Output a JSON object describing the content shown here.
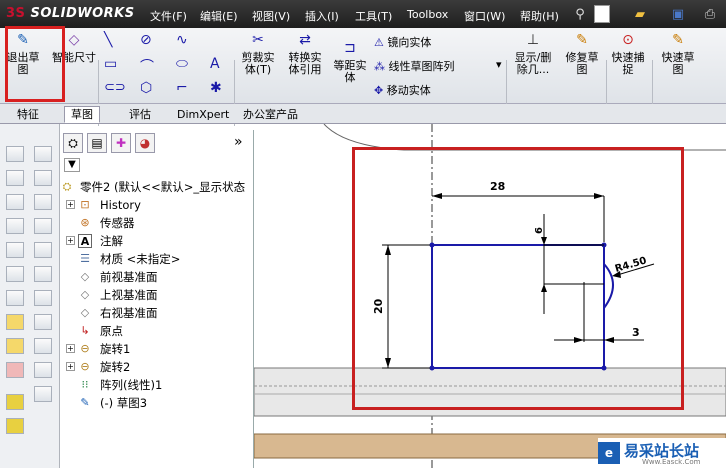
{
  "app": {
    "logo_prefix": "3S",
    "logo_text": "SOLIDWORKS"
  },
  "menu": [
    "文件(F)",
    "编辑(E)",
    "视图(V)",
    "插入(I)",
    "工具(T)",
    "Toolbox",
    "窗口(W)",
    "帮助(H)"
  ],
  "ribbon": {
    "exit_sketch": "退出草图",
    "smart_dimension": "智能尺寸",
    "trim": "剪裁实体(T)",
    "convert": "转换实体引用",
    "offset": "等距实体",
    "mirror": "镜向实体",
    "linear_pattern": "线性草图阵列",
    "move": "移动实体",
    "show_hide": "显示/删除几...",
    "repair": "修复草图",
    "quick_snap": "快速捕捉",
    "rapid_sketch": "快速草图"
  },
  "tabs": [
    "特征",
    "草图",
    "评估",
    "DimXpert",
    "办公室产品"
  ],
  "active_tab": "草图",
  "tree": {
    "root": "零件2  (默认<<默认>_显示状态",
    "items": [
      "History",
      "传感器",
      "注解",
      "材质 <未指定>",
      "前视基准面",
      "上视基准面",
      "右视基准面",
      "原点",
      "旋转1",
      "旋转2",
      "阵列(线性)1",
      "(-) 草图3"
    ]
  },
  "drawing": {
    "dim_width": "28",
    "dim_height": "20",
    "dim_small": "6",
    "dim_radius": "R4.50",
    "dim_offset": "3"
  },
  "watermark": {
    "text": "易采站长站",
    "sub": "Www.Easck.Com"
  },
  "colors": {
    "accent": "#c82020",
    "sketch_line": "#1a1aa8",
    "titlebar": "#2b2b2b"
  }
}
